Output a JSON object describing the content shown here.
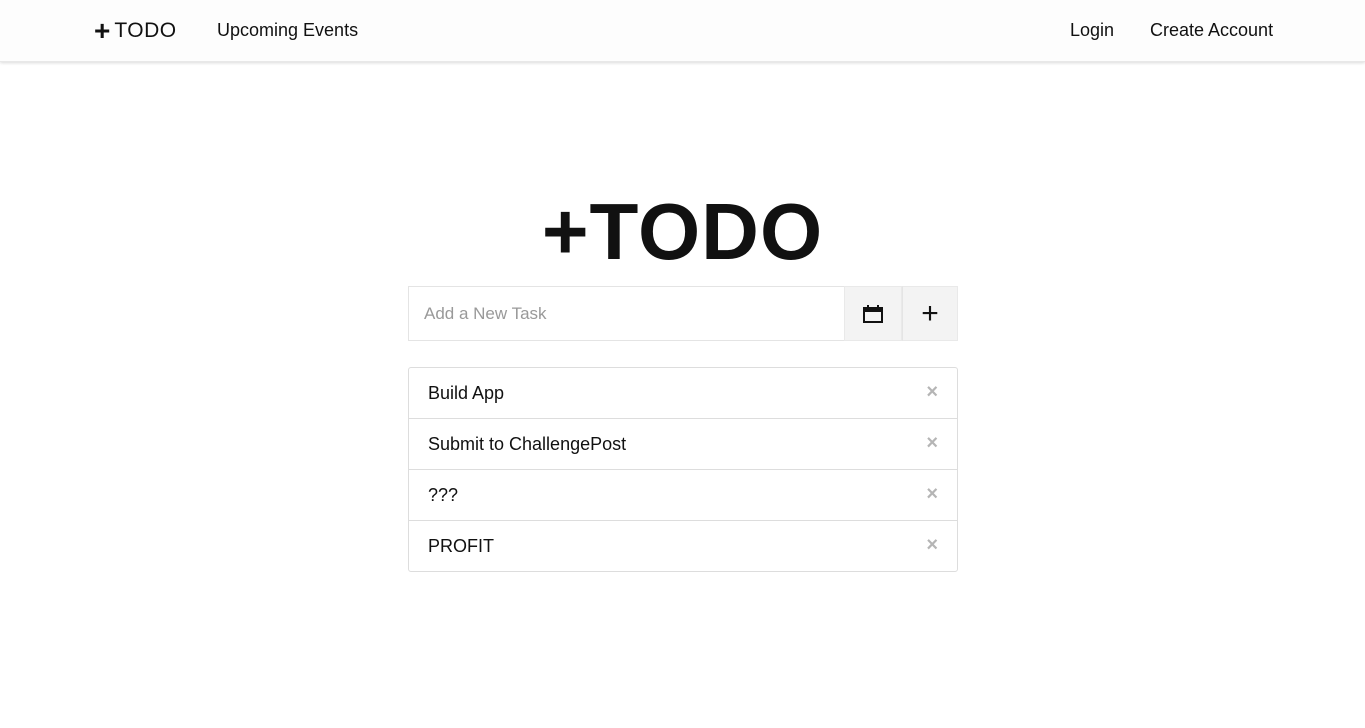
{
  "navbar": {
    "brand_plus": "+",
    "brand_text": "TODO",
    "upcoming_events": "Upcoming Events",
    "login": "Login",
    "create_account": "Create Account"
  },
  "hero": {
    "title": "+TODO"
  },
  "new_task": {
    "placeholder": "Add a New Task",
    "value": "",
    "calendar_icon": "calendar-icon",
    "add_button_label": "+"
  },
  "tasks": [
    {
      "label": "Build App",
      "remove": "×"
    },
    {
      "label": "Submit to ChallengePost",
      "remove": "×"
    },
    {
      "label": "???",
      "remove": "×"
    },
    {
      "label": "PROFIT",
      "remove": "×"
    }
  ],
  "colors": {
    "text": "#111111",
    "navbar_bg": "#fdfdfd",
    "button_bg": "#f3f3f3",
    "border": "#dddddd",
    "remove_icon": "#b5b5b5",
    "placeholder": "#999999"
  }
}
